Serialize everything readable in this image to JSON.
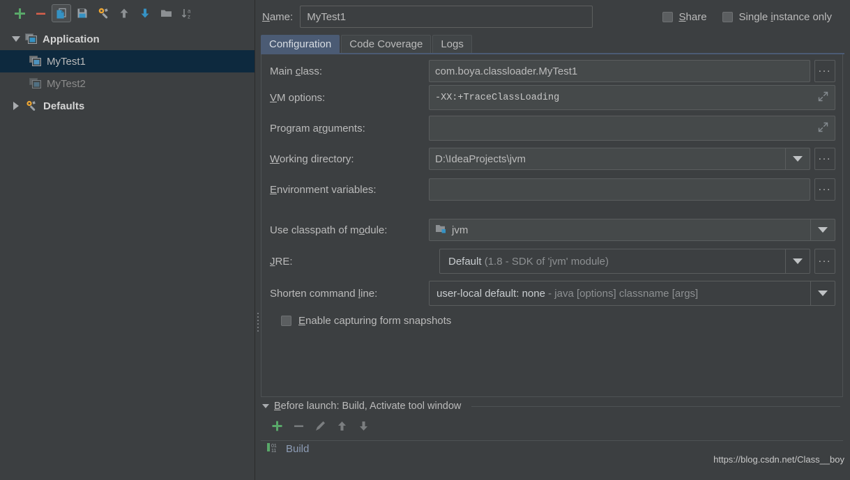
{
  "toolbar": {
    "buttons": [
      {
        "name": "add",
        "icon": "plus-icon"
      },
      {
        "name": "remove",
        "icon": "minus-icon"
      },
      {
        "name": "copy",
        "icon": "copy-icon"
      },
      {
        "name": "save",
        "icon": "save-icon"
      },
      {
        "name": "edit-defaults",
        "icon": "wrench-icon"
      },
      {
        "name": "move-up",
        "icon": "arrow-up-icon"
      },
      {
        "name": "move-down",
        "icon": "arrow-down-icon"
      },
      {
        "name": "new-folder",
        "icon": "folder-icon"
      },
      {
        "name": "sort-alphabetically",
        "icon": "sort-az-icon"
      }
    ]
  },
  "tree": {
    "nodes": [
      {
        "label": "Application",
        "level": 0,
        "expanded": true,
        "icon": "application-icon",
        "selected": false
      },
      {
        "label": "MyTest1",
        "level": 1,
        "icon": "application-icon",
        "selected": true
      },
      {
        "label": "MyTest2",
        "level": 1,
        "icon": "application-icon",
        "selected": false
      },
      {
        "label": "Defaults",
        "level": 0,
        "expanded": false,
        "icon": "wrench-icon",
        "selected": false
      }
    ]
  },
  "header": {
    "name_label": "Name:",
    "name_value": "MyTest1",
    "share_label": "Share",
    "share_checked": false,
    "single_instance_label": "Single instance only",
    "single_instance_checked": false
  },
  "tabs": [
    {
      "label": "Configuration",
      "active": true
    },
    {
      "label": "Code Coverage",
      "active": false
    },
    {
      "label": "Logs",
      "active": false
    }
  ],
  "form": {
    "main_class": {
      "label": "Main class:",
      "value": "com.boya.classloader.MyTest1",
      "browse": "..."
    },
    "vm_options": {
      "label": "VM options:",
      "value": "-XX:+TraceClassLoading"
    },
    "program_arguments": {
      "label": "Program arguments:",
      "value": ""
    },
    "working_directory": {
      "label": "Working directory:",
      "value": "D:\\IdeaProjects\\jvm",
      "browse": "..."
    },
    "environment_variables": {
      "label": "Environment variables:",
      "value": "",
      "browse": "..."
    },
    "use_classpath_of_module": {
      "label": "Use classpath of module:",
      "value": "jvm"
    },
    "jre": {
      "label": "JRE:",
      "value": "Default",
      "value_hint": "(1.8 - SDK of 'jvm' module)",
      "browse": "..."
    },
    "shorten_command_line": {
      "label": "Shorten command line:",
      "value": "user-local default: none",
      "value_hint": "- java [options] classname [args]"
    },
    "enable_capturing": {
      "label": "Enable capturing form snapshots",
      "checked": false
    }
  },
  "before_launch": {
    "title": "Before launch: Build, Activate tool window",
    "expanded": true,
    "toolbar": [
      {
        "name": "add",
        "icon": "plus-icon",
        "enabled": true
      },
      {
        "name": "remove",
        "icon": "minus-icon",
        "enabled": false
      },
      {
        "name": "edit",
        "icon": "pencil-icon",
        "enabled": false
      },
      {
        "name": "move-up",
        "icon": "arrow-up-icon",
        "enabled": false
      },
      {
        "name": "move-down",
        "icon": "arrow-down-icon",
        "enabled": false
      }
    ],
    "items": [
      {
        "label": "Build",
        "icon": "build-icon"
      }
    ]
  },
  "watermark": "https://blog.csdn.net/Class__boy",
  "colors": {
    "background": "#3c3f41",
    "selection": "#0d293e",
    "tab_active": "#4b5b74",
    "field_bg": "#45494a",
    "border": "#5a5d5e",
    "text": "#bbbbbb",
    "accent_green": "#4caf50",
    "accent_red": "#d9604c",
    "accent_blue": "#3592c4"
  }
}
